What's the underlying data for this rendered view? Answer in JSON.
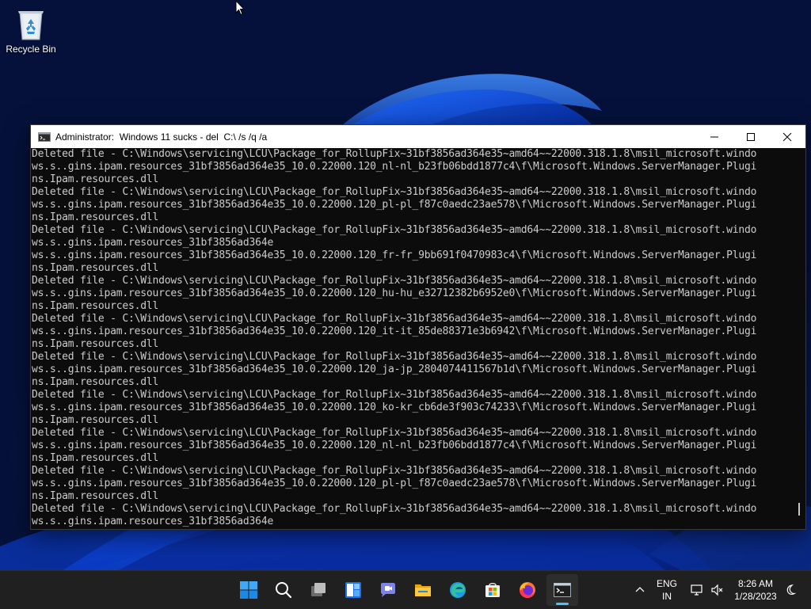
{
  "desktop": {
    "icons": [
      {
        "label": "Recycle Bin",
        "icon": "recycle-bin-icon"
      }
    ]
  },
  "window": {
    "title": "Administrator:  Windows 11 sucks - del  C:\\ /s /q /a",
    "app_icon": "command-prompt-icon",
    "controls": {
      "minimize": "minimize-icon",
      "maximize": "maximize-icon",
      "close": "close-icon"
    }
  },
  "console": {
    "lines": [
      "Deleted file - C:\\Windows\\servicing\\LCU\\Package_for_RollupFix~31bf3856ad364e35~amd64~~22000.318.1.8\\msil_microsoft.windo",
      "ws.s..gins.ipam.resources_31bf3856ad364e35_10.0.22000.120_nl-nl_b23fb06bdd1877c4\\f\\Microsoft.Windows.ServerManager.Plugi",
      "ns.Ipam.resources.dll",
      "Deleted file - C:\\Windows\\servicing\\LCU\\Package_for_RollupFix~31bf3856ad364e35~amd64~~22000.318.1.8\\msil_microsoft.windo",
      "ws.s..gins.ipam.resources_31bf3856ad364e35_10.0.22000.120_pl-pl_f87c0aedc23ae578\\f\\Microsoft.Windows.ServerManager.Plugi",
      "ns.Ipam.resources.dll",
      "Deleted file - C:\\Windows\\servicing\\LCU\\Package_for_RollupFix~31bf3856ad364e35~amd64~~22000.318.1.8\\msil_microsoft.windo",
      "ws.s..gins.ipam.resources_31bf3856ad364e",
      "ws.s..gins.ipam.resources_31bf3856ad364e35_10.0.22000.120_fr-fr_9bb691f0470983c4\\f\\Microsoft.Windows.ServerManager.Plugi",
      "ns.Ipam.resources.dll",
      "Deleted file - C:\\Windows\\servicing\\LCU\\Package_for_RollupFix~31bf3856ad364e35~amd64~~22000.318.1.8\\msil_microsoft.windo",
      "ws.s..gins.ipam.resources_31bf3856ad364e35_10.0.22000.120_hu-hu_e32712382b6952e0\\f\\Microsoft.Windows.ServerManager.Plugi",
      "ns.Ipam.resources.dll",
      "Deleted file - C:\\Windows\\servicing\\LCU\\Package_for_RollupFix~31bf3856ad364e35~amd64~~22000.318.1.8\\msil_microsoft.windo",
      "ws.s..gins.ipam.resources_31bf3856ad364e35_10.0.22000.120_it-it_85de88371e3b6942\\f\\Microsoft.Windows.ServerManager.Plugi",
      "ns.Ipam.resources.dll",
      "Deleted file - C:\\Windows\\servicing\\LCU\\Package_for_RollupFix~31bf3856ad364e35~amd64~~22000.318.1.8\\msil_microsoft.windo",
      "ws.s..gins.ipam.resources_31bf3856ad364e35_10.0.22000.120_ja-jp_2804074411567b1d\\f\\Microsoft.Windows.ServerManager.Plugi",
      "ns.Ipam.resources.dll",
      "Deleted file - C:\\Windows\\servicing\\LCU\\Package_for_RollupFix~31bf3856ad364e35~amd64~~22000.318.1.8\\msil_microsoft.windo",
      "ws.s..gins.ipam.resources_31bf3856ad364e35_10.0.22000.120_ko-kr_cb6de3f903c74233\\f\\Microsoft.Windows.ServerManager.Plugi",
      "ns.Ipam.resources.dll",
      "Deleted file - C:\\Windows\\servicing\\LCU\\Package_for_RollupFix~31bf3856ad364e35~amd64~~22000.318.1.8\\msil_microsoft.windo",
      "ws.s..gins.ipam.resources_31bf3856ad364e35_10.0.22000.120_nl-nl_b23fb06bdd1877c4\\f\\Microsoft.Windows.ServerManager.Plugi",
      "ns.Ipam.resources.dll",
      "Deleted file - C:\\Windows\\servicing\\LCU\\Package_for_RollupFix~31bf3856ad364e35~amd64~~22000.318.1.8\\msil_microsoft.windo",
      "ws.s..gins.ipam.resources_31bf3856ad364e35_10.0.22000.120_pl-pl_f87c0aedc23ae578\\f\\Microsoft.Windows.ServerManager.Plugi",
      "ns.Ipam.resources.dll",
      "Deleted file - C:\\Windows\\servicing\\LCU\\Package_for_RollupFix~31bf3856ad364e35~amd64~~22000.318.1.8\\msil_microsoft.windo",
      "ws.s..gins.ipam.resources_31bf3856ad364e"
    ]
  },
  "taskbar": {
    "apps": [
      {
        "name": "start-button",
        "icon": "windows-logo-icon"
      },
      {
        "name": "search-button",
        "icon": "search-icon"
      },
      {
        "name": "task-view-button",
        "icon": "task-view-icon"
      },
      {
        "name": "widgets-button",
        "icon": "widgets-icon"
      },
      {
        "name": "chat-button",
        "icon": "teams-chat-icon"
      },
      {
        "name": "file-explorer-button",
        "icon": "folder-icon"
      },
      {
        "name": "edge-button",
        "icon": "edge-icon"
      },
      {
        "name": "store-button",
        "icon": "store-icon"
      },
      {
        "name": "firefox-button",
        "icon": "firefox-icon"
      },
      {
        "name": "terminal-button",
        "icon": "command-prompt-icon",
        "active": true
      }
    ],
    "tray": {
      "language_line1": "ENG",
      "language_line2": "IN",
      "time": "8:26 AM",
      "date": "1/28/2023"
    }
  },
  "colors": {
    "accent": "#4cc2ff",
    "console_bg": "#0c0c0c",
    "console_text": "#cccccc",
    "taskbar_bg": "#202020"
  }
}
